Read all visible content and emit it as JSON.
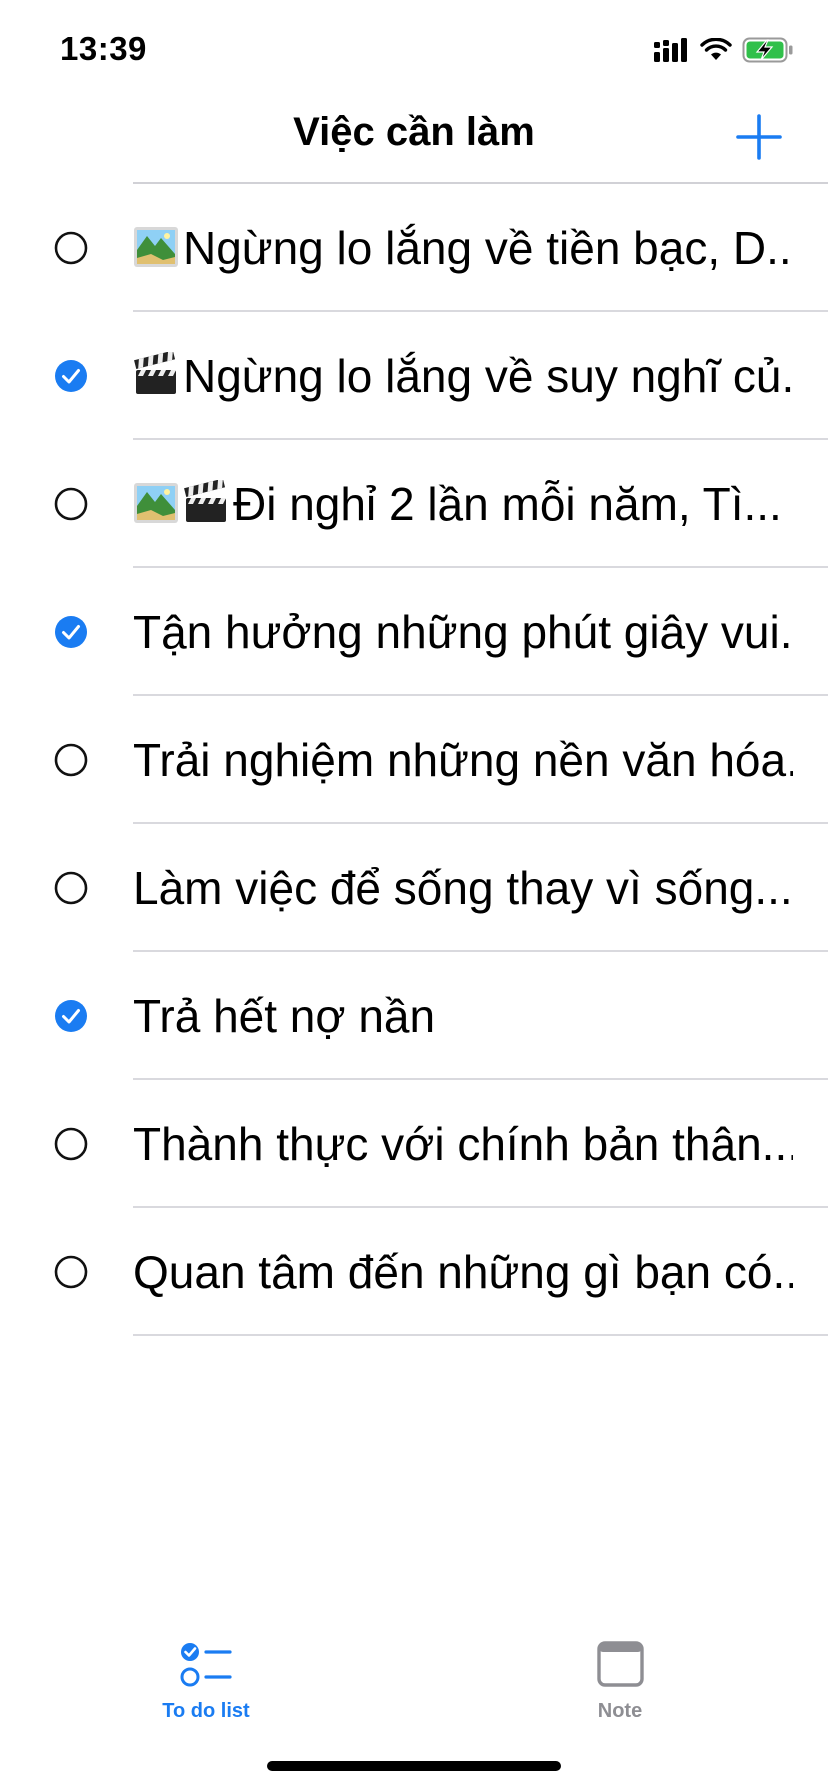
{
  "status_bar": {
    "time": "13:39",
    "icons": [
      "cellular-signal-icon",
      "wifi-icon",
      "battery-charging-icon"
    ]
  },
  "nav": {
    "title": "Việc cần làm",
    "add_icon": "plus-icon"
  },
  "colors": {
    "accent": "#1a7cf2",
    "divider": "#d9d9de",
    "tab_inactive": "#8e8e93"
  },
  "todos": [
    {
      "text": "Ngừng lo lắng về tiền bạc, D...",
      "done": false,
      "attachments": [
        "image-icon"
      ]
    },
    {
      "text": "Ngừng lo lắng về suy nghĩ củ...",
      "done": true,
      "attachments": [
        "clapper-icon"
      ]
    },
    {
      "text": "Đi nghỉ 2 lần mỗi năm, Tì...",
      "done": false,
      "attachments": [
        "image-icon",
        "clapper-icon"
      ]
    },
    {
      "text": "Tận hưởng những phút giây vui...",
      "done": true,
      "attachments": []
    },
    {
      "text": "Trải nghiệm những nền văn hóa...",
      "done": false,
      "attachments": []
    },
    {
      "text": "Làm việc để sống thay vì sống...",
      "done": false,
      "attachments": []
    },
    {
      "text": "Trả hết nợ nần",
      "done": true,
      "attachments": []
    },
    {
      "text": "Thành thực với chính bản thân...",
      "done": false,
      "attachments": []
    },
    {
      "text": "Quan tâm đến những gì bạn có...",
      "done": false,
      "attachments": []
    }
  ],
  "tabs": [
    {
      "label": "To do list",
      "icon": "checklist-icon",
      "active": true
    },
    {
      "label": "Note",
      "icon": "window-icon",
      "active": false
    }
  ]
}
